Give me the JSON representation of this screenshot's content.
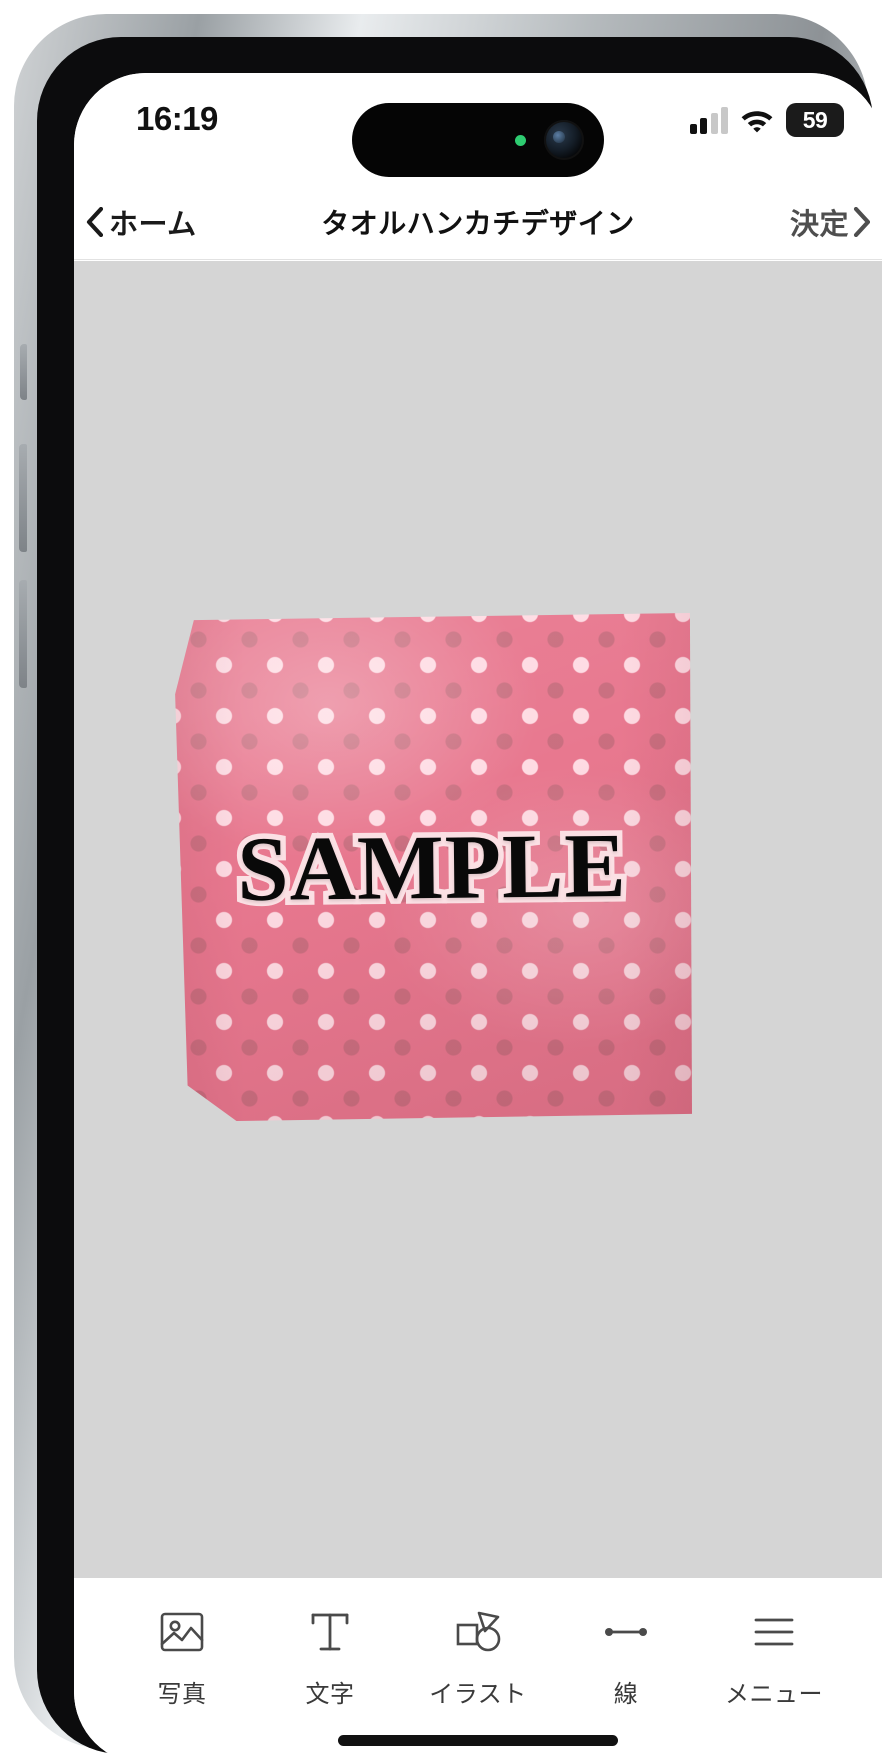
{
  "status_bar": {
    "time": "16:19",
    "cellular_icon": "cellular-bars-icon",
    "wifi_icon": "wifi-icon",
    "battery_level": "59"
  },
  "dynamic_island": {
    "indicator_icon": "green-recording-dot-icon",
    "camera_icon": "front-camera-icon"
  },
  "nav_bar": {
    "back_icon": "chevron-left-icon",
    "back_label": "ホーム",
    "title": "タオルハンカチデザイン",
    "confirm_label": "決定",
    "confirm_icon": "chevron-right-icon"
  },
  "canvas": {
    "background_color": "#d5d5d5",
    "product": {
      "name": "towel-handkerchief-preview",
      "base_color": "#e8788f",
      "dot_light_color": "#ffe1e8",
      "dot_dark_color": "#b76876",
      "pattern": "polka-dot",
      "sample_text": "SAMPLE",
      "sample_text_color": "#090909",
      "sample_text_outline_color": "#fbe0e4"
    }
  },
  "toolbar": {
    "items": [
      {
        "label": "写真",
        "icon": "photo-icon",
        "name": "tool-photo"
      },
      {
        "label": "文字",
        "icon": "text-t-icon",
        "name": "tool-text"
      },
      {
        "label": "イラスト",
        "icon": "illustration-icon",
        "name": "tool-illustration"
      },
      {
        "label": "線",
        "icon": "line-icon",
        "name": "tool-line"
      },
      {
        "label": "メニュー",
        "icon": "hamburger-menu-icon",
        "name": "tool-menu"
      }
    ]
  }
}
